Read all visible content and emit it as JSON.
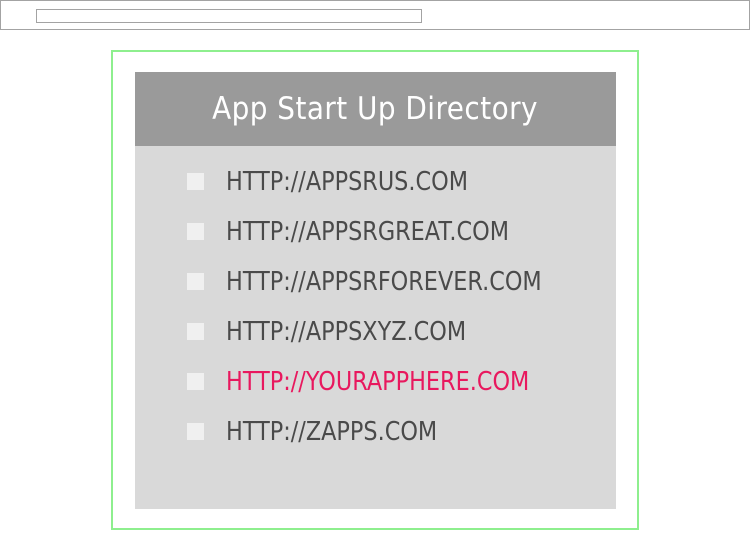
{
  "browser": {
    "address_value": ""
  },
  "directory": {
    "title": "App Start Up Directory",
    "links": [
      {
        "label": "HTTP://APPSRUS.COM",
        "highlighted": false
      },
      {
        "label": "HTTP://APPSRGREAT.COM",
        "highlighted": false
      },
      {
        "label": "HTTP://APPSRFOREVER.COM",
        "highlighted": false
      },
      {
        "label": "HTTP://APPSXYZ.COM",
        "highlighted": false
      },
      {
        "label": "HTTP://YOURAPPHERE.COM",
        "highlighted": true
      },
      {
        "label": "HTTP://ZAPPS.COM",
        "highlighted": false
      }
    ]
  },
  "colors": {
    "frame_border": "#8eef8e",
    "header_bg": "#9a9a9a",
    "panel_bg": "#d9d9d9",
    "link_text": "#4a4a4a",
    "highlight_link": "#e8185e",
    "bullet": "#f0f0f0"
  }
}
